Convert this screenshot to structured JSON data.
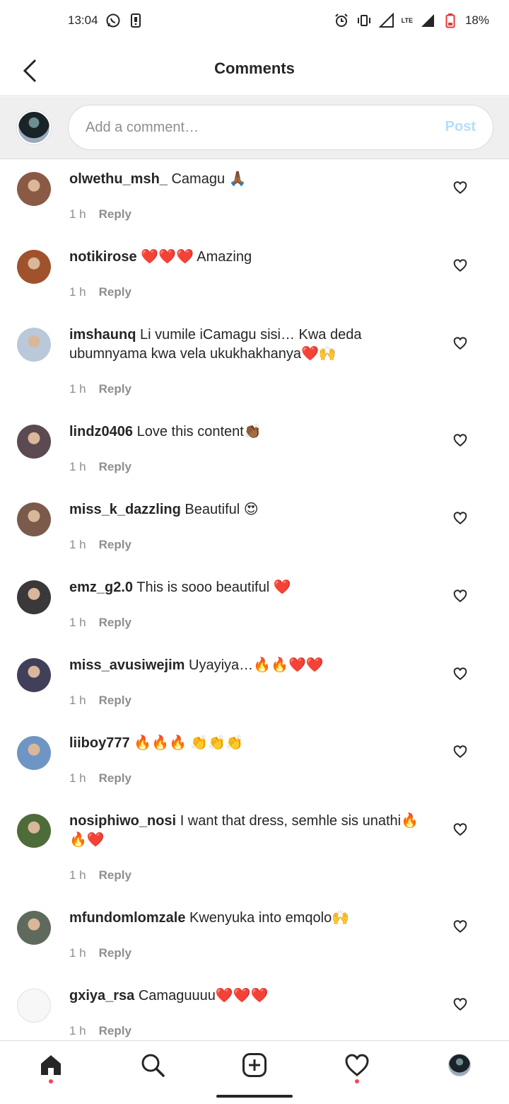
{
  "status_bar": {
    "time": "13:04",
    "battery": "18%",
    "network": "LTE",
    "icons": [
      "whatsapp-icon",
      "sim-icon",
      "alarm-icon",
      "vibrate-icon",
      "signal-icon",
      "battery-icon"
    ]
  },
  "header": {
    "title": "Comments"
  },
  "compose": {
    "placeholder": "Add a comment…",
    "post_label": "Post"
  },
  "comments": [
    {
      "user": "olwethu_msh_",
      "text": "Camagu 🙏🏾",
      "time": "1 h",
      "reply": "Reply",
      "avatar_color": "#8a5a44"
    },
    {
      "user": "notikirose",
      "text": "❤️❤️❤️ Amazing",
      "time": "1 h",
      "reply": "Reply",
      "avatar_color": "#a0522d"
    },
    {
      "user": "imshaunq",
      "text": "Li vumile iCamagu sisi… Kwa deda ubumnyama kwa vela ukukhakhanya❤️🙌",
      "time": "1 h",
      "reply": "Reply",
      "avatar_color": "#b9c9d9"
    },
    {
      "user": "lindz0406",
      "text": "Love this content👏🏾",
      "time": "1 h",
      "reply": "Reply",
      "avatar_color": "#5b4a52"
    },
    {
      "user": "miss_k_dazzling",
      "text": "Beautiful 😍",
      "time": "1 h",
      "reply": "Reply",
      "avatar_color": "#7b5a4c"
    },
    {
      "user": "emz_g2.0",
      "text": "This is sooo beautiful ❤️",
      "time": "1 h",
      "reply": "Reply",
      "avatar_color": "#3a3838"
    },
    {
      "user": "miss_avusiwejim",
      "text": "Uyayiya…🔥🔥❤️❤️",
      "time": "1 h",
      "reply": "Reply",
      "avatar_color": "#40405a"
    },
    {
      "user": "liiboy777",
      "text": "🔥🔥🔥 👏👏👏",
      "time": "1 h",
      "reply": "Reply",
      "avatar_color": "#6f95c4"
    },
    {
      "user": "nosiphiwo_nosi",
      "text": "I want that dress, semhle sis unathi🔥🔥❤️",
      "time": "1 h",
      "reply": "Reply",
      "avatar_color": "#4e6b3a"
    },
    {
      "user": "mfundomlomzale",
      "text": "Kwenyuka into emqolo🙌",
      "time": "1 h",
      "reply": "Reply",
      "avatar_color": "#5f6a5c"
    },
    {
      "user": "gxiya_rsa",
      "text": "Camaguuuu❤️❤️❤️",
      "time": "1 h",
      "reply": "Reply",
      "avatar_color": "#f7f7f7"
    }
  ],
  "nav": {
    "items": [
      "home-icon",
      "search-icon",
      "new-post-icon",
      "activity-icon",
      "profile-icon"
    ]
  }
}
